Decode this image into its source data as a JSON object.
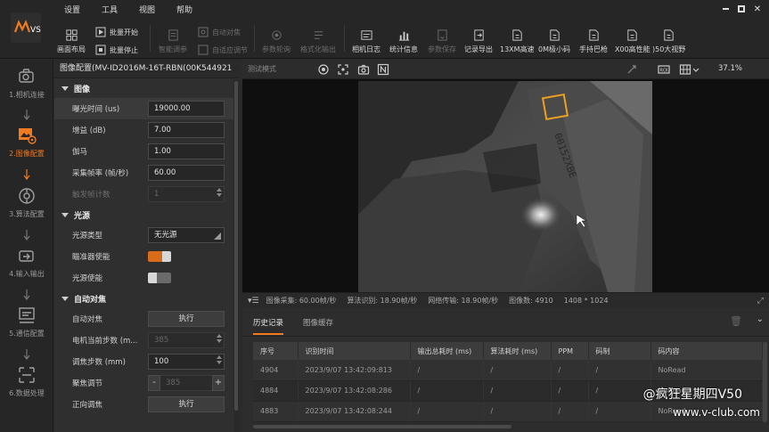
{
  "menu": [
    "设置",
    "工具",
    "视图",
    "帮助"
  ],
  "toolbar": {
    "layout": "画面布局",
    "batch_start": "批量开始",
    "batch_stop": "批量停止",
    "smart_tune": "智能调参",
    "auto_focus": "自动对焦",
    "auto_adjust": "自适应调节",
    "param_poll": "参数轮询",
    "format_output": "格式化输出",
    "camera_log": "相机日志",
    "stats": "统计信息",
    "param_save": "参数保存",
    "record_export": "记录导出",
    "b1": "13XM高速",
    "b2": "0M极小码",
    "b3": "手持巴枪",
    "b4": "X00高性能",
    "b5": ")50大视野"
  },
  "steps": [
    {
      "label": "1.相机连接"
    },
    {
      "label": "2.图像配置"
    },
    {
      "label": "3.算法配置"
    },
    {
      "label": "4.输入输出"
    },
    {
      "label": "5.通信配置"
    },
    {
      "label": "6.数据处理"
    }
  ],
  "config": {
    "title": "图像配置(MV-ID2016M-16T-RBN(00K544921",
    "image_section": "图像",
    "exposure_label": "曝光时间 (us)",
    "exposure_value": "19000.00",
    "gain_label": "增益 (dB)",
    "gain_value": "7.00",
    "gamma_label": "伽马",
    "gamma_value": "1.00",
    "fps_label": "采集帧率 (帧/秒)",
    "fps_value": "60.00",
    "trigger_label": "触发帧计数",
    "trigger_value": "1",
    "light_section": "光源",
    "light_type_label": "光源类型",
    "light_type_value": "无光源",
    "aimer_label": "瞄准器使能",
    "light_enable_label": "光源使能",
    "af_section": "自动对焦",
    "af_label": "自动对焦",
    "af_button": "执行",
    "motor_label": "电机当前步数 (m...",
    "motor_value": "385",
    "focus_step_label": "调焦步数 (mm)",
    "focus_step_value": "100",
    "focus_adj_label": "聚焦调节",
    "focus_adj_minus": "-",
    "focus_adj_value": "385",
    "focus_adj_plus": "+",
    "fwd_label": "正向调焦",
    "fwd_button": "执行"
  },
  "view": {
    "mode": "测试模式",
    "zoom": "37.1%"
  },
  "status": {
    "capture": "图像采集: 60.00帧/秒",
    "algo": "算法识别: 18.90帧/秒",
    "network": "网络传输: 18.90帧/秒",
    "count": "图像数: 4910",
    "resolution": "1408 * 1024"
  },
  "history": {
    "tab_history": "历史记录",
    "tab_cache": "图像缓存",
    "columns": [
      "序号",
      "识别时间",
      "输出总耗时 (ms)",
      "算法耗时 (ms)",
      "PPM",
      "码制",
      "码内容"
    ],
    "rows": [
      [
        "4904",
        "2023/9/07 13:42:09:813",
        "/",
        "/",
        "/",
        "/",
        "NoRead"
      ],
      [
        "4884",
        "2023/9/07 13:42:08:286",
        "/",
        "/",
        "/",
        "/",
        "NoRead"
      ],
      [
        "4883",
        "2023/9/07 13:42:08:244",
        "/",
        "/",
        "/",
        "/",
        "NoRead"
      ]
    ]
  },
  "watermark": {
    "line1": "@疯狂星期四V50",
    "line2": "www.v-club.com"
  },
  "colors": {
    "accent": "#f07a1f",
    "roi": "#f0a020"
  }
}
